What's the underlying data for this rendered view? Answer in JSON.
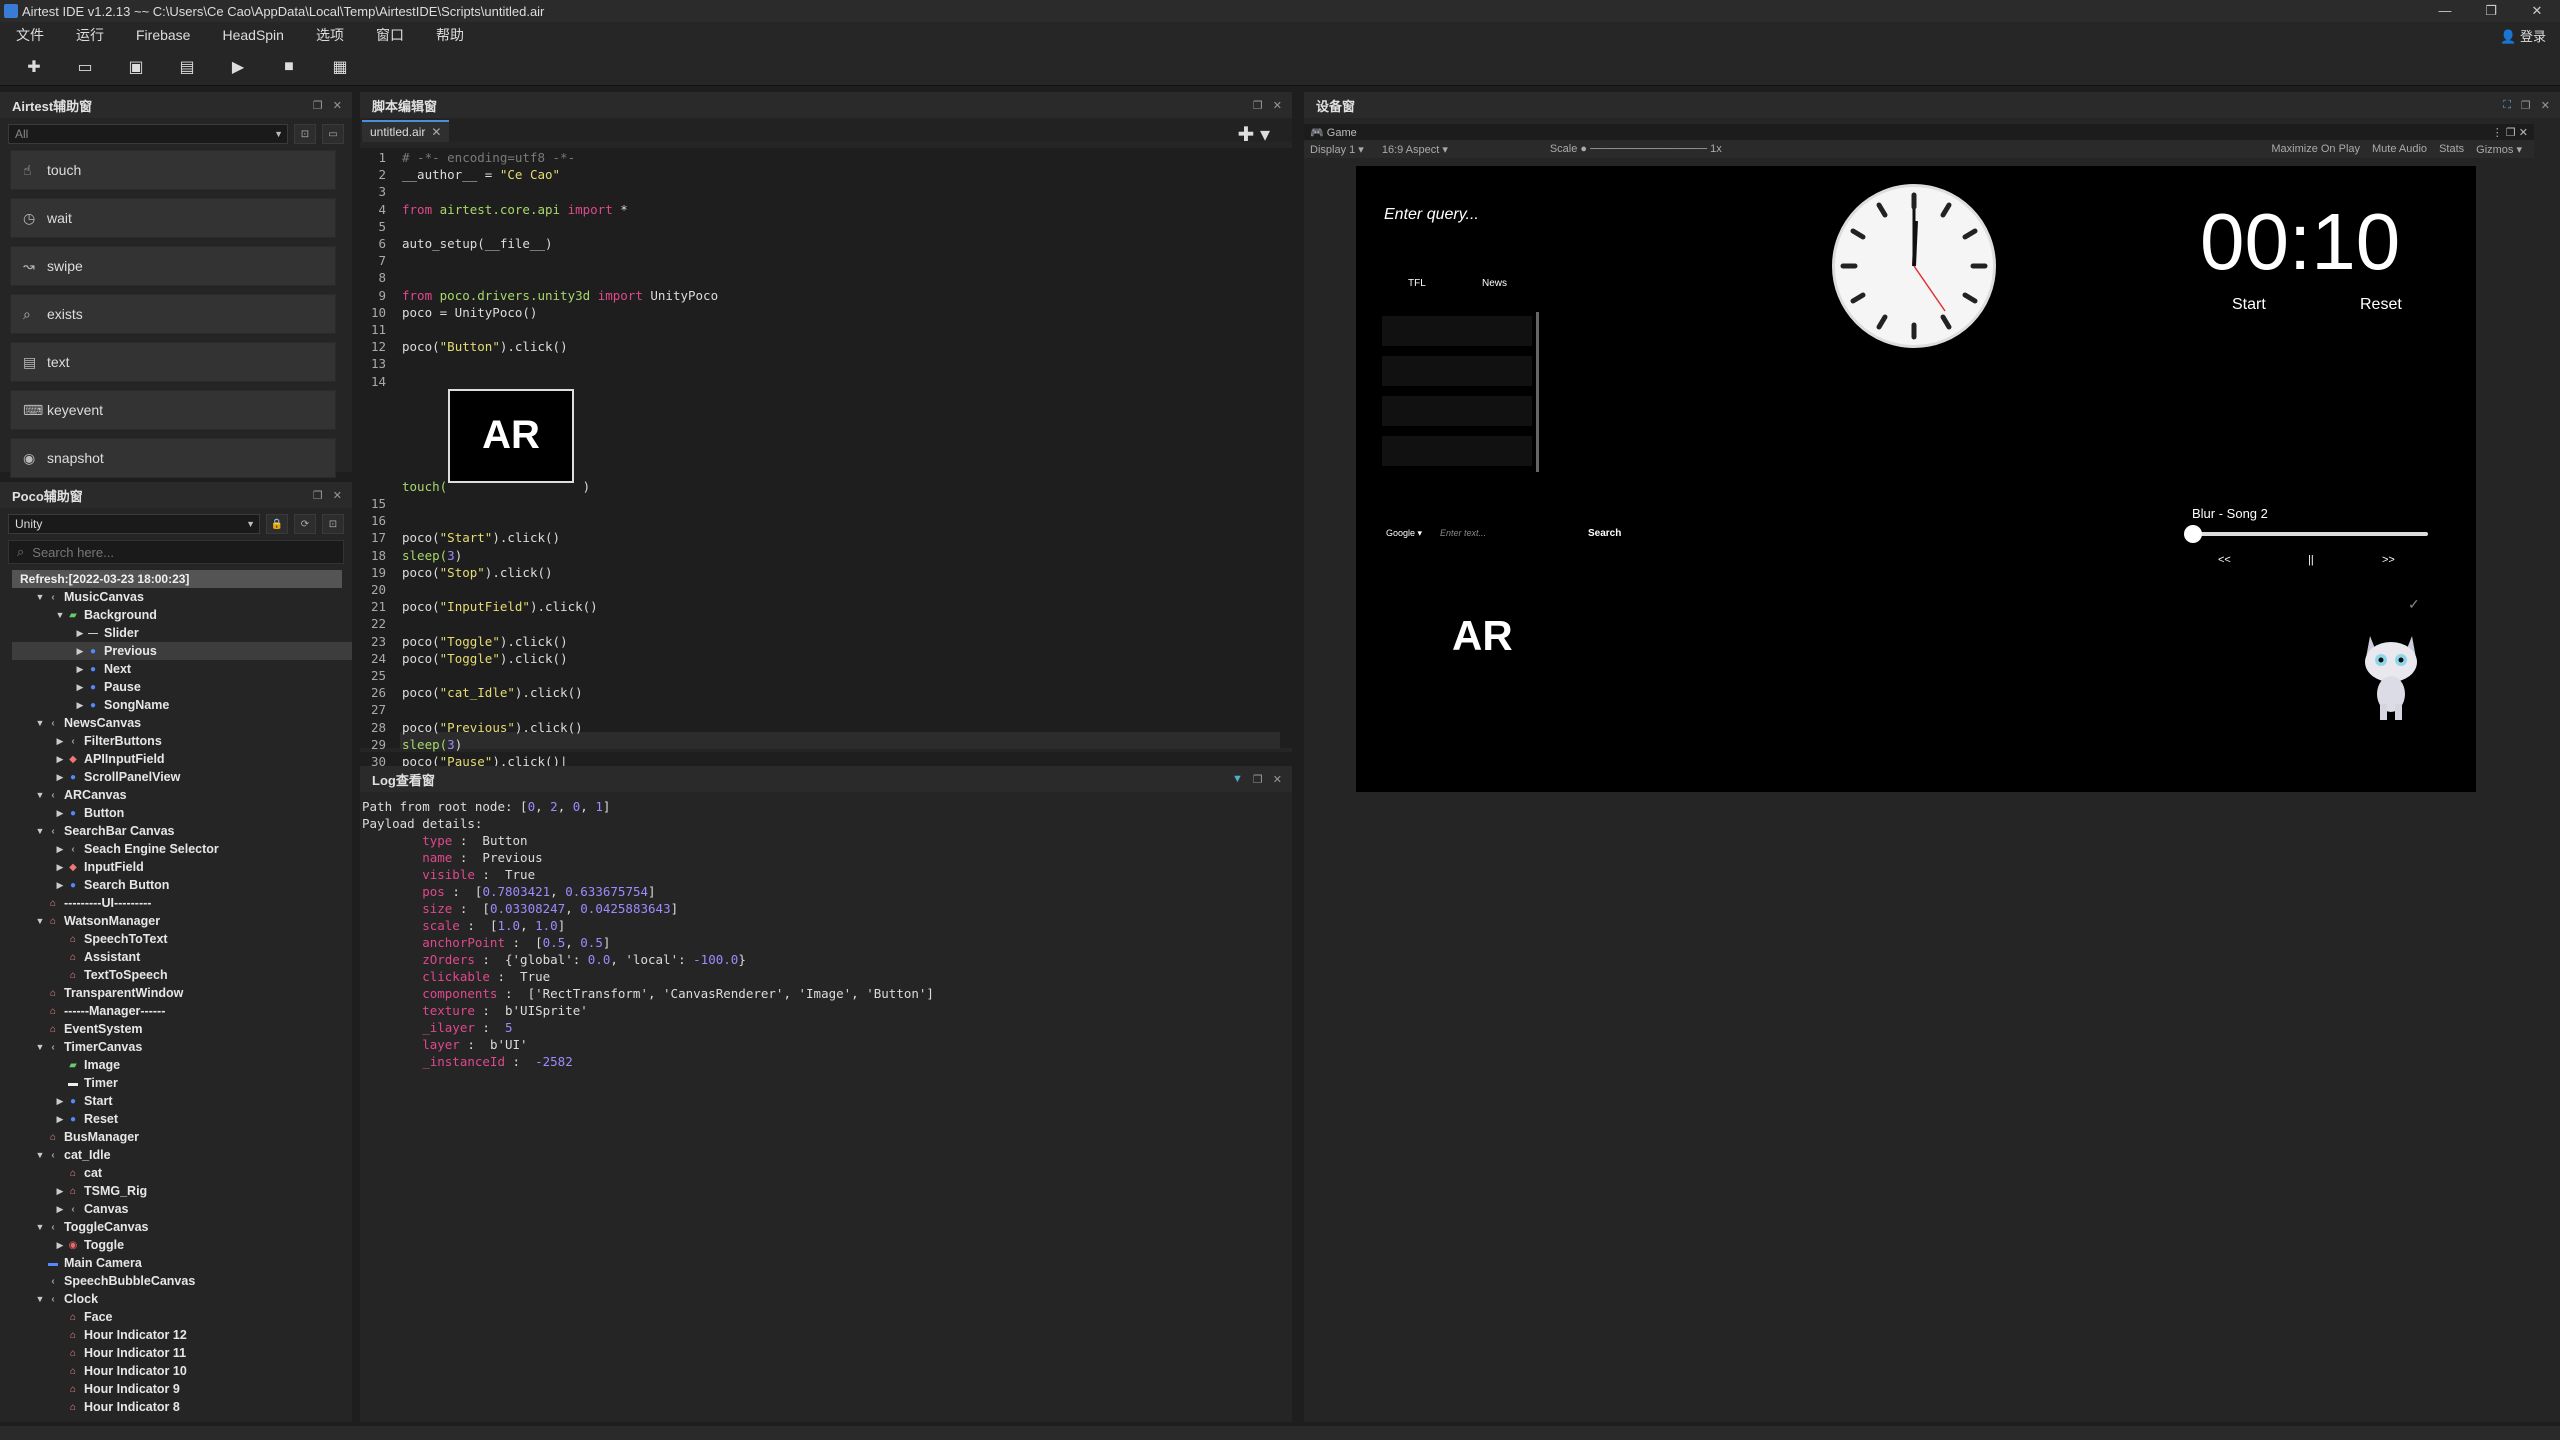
{
  "window": {
    "title": "Airtest IDE v1.2.13 ~~ C:\\Users\\Ce Cao\\AppData\\Local\\Temp\\AirtestIDE\\Scripts\\untitled.air",
    "controls": [
      "—",
      "❐",
      "✕"
    ]
  },
  "menu": {
    "items": [
      "文件",
      "运行",
      "Firebase",
      "HeadSpin",
      "选项",
      "窗口",
      "帮助"
    ],
    "login": "登录"
  },
  "toolbar": {
    "icons": [
      "new-file-icon",
      "open-folder-icon",
      "save-icon",
      "save-as-icon",
      "run-icon",
      "stop-icon",
      "log-icon"
    ]
  },
  "airtest_panel": {
    "title": "Airtest辅助窗",
    "filter": "All",
    "commands": [
      "touch",
      "wait",
      "swipe",
      "exists",
      "text",
      "keyevent",
      "snapshot"
    ]
  },
  "poco_panel": {
    "title": "Poco辅助窗",
    "mode": "Unity",
    "search_placeholder": "Search here...",
    "refresh": "Refresh:[2022-03-23 18:00:23]",
    "tree": [
      {
        "label": "MusicCanvas",
        "depth": 0,
        "arrow": "▼",
        "icon": "canvas"
      },
      {
        "label": "Background",
        "depth": 1,
        "arrow": "▼",
        "icon": "image"
      },
      {
        "label": "Slider",
        "depth": 2,
        "arrow": "▶",
        "icon": "slider"
      },
      {
        "label": "Previous",
        "depth": 2,
        "arrow": "▶",
        "icon": "button",
        "selected": true
      },
      {
        "label": "Next",
        "depth": 2,
        "arrow": "▶",
        "icon": "button"
      },
      {
        "label": "Pause",
        "depth": 2,
        "arrow": "▶",
        "icon": "button"
      },
      {
        "label": "SongName",
        "depth": 2,
        "arrow": "▶",
        "icon": "button"
      },
      {
        "label": "NewsCanvas",
        "depth": 0,
        "arrow": "▼",
        "icon": "canvas"
      },
      {
        "label": "FilterButtons",
        "depth": 1,
        "arrow": "▶",
        "icon": "canvas"
      },
      {
        "label": "APIInputField",
        "depth": 1,
        "arrow": "▶",
        "icon": "input"
      },
      {
        "label": "ScrollPanelView",
        "depth": 1,
        "arrow": "▶",
        "icon": "button"
      },
      {
        "label": "ARCanvas",
        "depth": 0,
        "arrow": "▼",
        "icon": "canvas"
      },
      {
        "label": "Button",
        "depth": 1,
        "arrow": "▶",
        "icon": "button"
      },
      {
        "label": "SearchBar Canvas",
        "depth": 0,
        "arrow": "▼",
        "icon": "canvas"
      },
      {
        "label": "Seach Engine Selector",
        "depth": 1,
        "arrow": "▶",
        "icon": "canvas"
      },
      {
        "label": "InputField",
        "depth": 1,
        "arrow": "▶",
        "icon": "input"
      },
      {
        "label": "Search Button",
        "depth": 1,
        "arrow": "▶",
        "icon": "button"
      },
      {
        "label": "---------UI---------",
        "depth": 0,
        "arrow": "",
        "icon": "node"
      },
      {
        "label": "WatsonManager",
        "depth": 0,
        "arrow": "▼",
        "icon": "node"
      },
      {
        "label": "SpeechToText",
        "depth": 1,
        "arrow": "",
        "icon": "node"
      },
      {
        "label": "Assistant",
        "depth": 1,
        "arrow": "",
        "icon": "node"
      },
      {
        "label": "TextToSpeech",
        "depth": 1,
        "arrow": "",
        "icon": "node"
      },
      {
        "label": "TransparentWindow",
        "depth": 0,
        "arrow": "",
        "icon": "node"
      },
      {
        "label": "------Manager------",
        "depth": 0,
        "arrow": "",
        "icon": "node"
      },
      {
        "label": "EventSystem",
        "depth": 0,
        "arrow": "",
        "icon": "node"
      },
      {
        "label": "TimerCanvas",
        "depth": 0,
        "arrow": "▼",
        "icon": "canvas"
      },
      {
        "label": "Image",
        "depth": 1,
        "arrow": "",
        "icon": "image"
      },
      {
        "label": "Timer",
        "depth": 1,
        "arrow": "",
        "icon": "text"
      },
      {
        "label": "Start",
        "depth": 1,
        "arrow": "▶",
        "icon": "button"
      },
      {
        "label": "Reset",
        "depth": 1,
        "arrow": "▶",
        "icon": "button"
      },
      {
        "label": "BusManager",
        "depth": 0,
        "arrow": "",
        "icon": "node"
      },
      {
        "label": "cat_Idle",
        "depth": 0,
        "arrow": "▼",
        "icon": "canvas"
      },
      {
        "label": "cat",
        "depth": 1,
        "arrow": "",
        "icon": "node"
      },
      {
        "label": "TSMG_Rig",
        "depth": 1,
        "arrow": "▶",
        "icon": "node"
      },
      {
        "label": "Canvas",
        "depth": 1,
        "arrow": "▶",
        "icon": "canvas"
      },
      {
        "label": "ToggleCanvas",
        "depth": 0,
        "arrow": "▼",
        "icon": "canvas"
      },
      {
        "label": "Toggle",
        "depth": 1,
        "arrow": "▶",
        "icon": "toggle"
      },
      {
        "label": "Main Camera",
        "depth": 0,
        "arrow": "",
        "icon": "camera"
      },
      {
        "label": "SpeechBubbleCanvas",
        "depth": 0,
        "arrow": "",
        "icon": "canvas"
      },
      {
        "label": "Clock",
        "depth": 0,
        "arrow": "▼",
        "icon": "canvas"
      },
      {
        "label": "Face",
        "depth": 1,
        "arrow": "",
        "icon": "node"
      },
      {
        "label": "Hour Indicator 12",
        "depth": 1,
        "arrow": "",
        "icon": "node"
      },
      {
        "label": "Hour Indicator 11",
        "depth": 1,
        "arrow": "",
        "icon": "node"
      },
      {
        "label": "Hour Indicator 10",
        "depth": 1,
        "arrow": "",
        "icon": "node"
      },
      {
        "label": "Hour Indicator 9",
        "depth": 1,
        "arrow": "",
        "icon": "node"
      },
      {
        "label": "Hour Indicator 8",
        "depth": 1,
        "arrow": "",
        "icon": "node"
      }
    ]
  },
  "editor": {
    "title": "脚本编辑窗",
    "tab": "untitled.air",
    "image_label": "AR",
    "lines": [
      {
        "n": "1",
        "segs": [
          {
            "t": "# -*- encoding=utf8 -*-",
            "c": "cm"
          }
        ]
      },
      {
        "n": "2",
        "segs": [
          {
            "t": "__author__ = ",
            "c": ""
          },
          {
            "t": "\"Ce Cao\"",
            "c": "st"
          }
        ]
      },
      {
        "n": "3",
        "segs": []
      },
      {
        "n": "4",
        "segs": [
          {
            "t": "from ",
            "c": "kw"
          },
          {
            "t": "airtest.core.api ",
            "c": "mod"
          },
          {
            "t": "import ",
            "c": "kw"
          },
          {
            "t": "*",
            "c": ""
          }
        ]
      },
      {
        "n": "5",
        "segs": []
      },
      {
        "n": "6",
        "segs": [
          {
            "t": "auto_setup(__file__)",
            "c": ""
          }
        ]
      },
      {
        "n": "7",
        "segs": []
      },
      {
        "n": "8",
        "segs": []
      },
      {
        "n": "9",
        "segs": [
          {
            "t": "from ",
            "c": "kw"
          },
          {
            "t": "poco.drivers.unity3d ",
            "c": "mod"
          },
          {
            "t": "import ",
            "c": "kw"
          },
          {
            "t": "UnityPoco",
            "c": ""
          }
        ]
      },
      {
        "n": "10",
        "segs": [
          {
            "t": "poco = UnityPoco()",
            "c": ""
          }
        ]
      },
      {
        "n": "11",
        "segs": []
      },
      {
        "n": "12",
        "segs": [
          {
            "t": "poco(",
            "c": ""
          },
          {
            "t": "\"Button\"",
            "c": "st"
          },
          {
            "t": ").click()",
            "c": ""
          }
        ]
      },
      {
        "n": "13",
        "segs": []
      },
      {
        "n": "14",
        "segs": []
      },
      {
        "n": "",
        "segs": [
          {
            "t": "touch(",
            "c": "mod"
          },
          {
            "t": "                  )",
            "c": ""
          }
        ]
      },
      {
        "n": "15",
        "segs": []
      },
      {
        "n": "16",
        "segs": []
      },
      {
        "n": "17",
        "segs": [
          {
            "t": "poco(",
            "c": ""
          },
          {
            "t": "\"Start\"",
            "c": "st"
          },
          {
            "t": ").click()",
            "c": ""
          }
        ]
      },
      {
        "n": "18",
        "segs": [
          {
            "t": "sleep(",
            "c": "mod"
          },
          {
            "t": "3",
            "c": "n"
          },
          {
            "t": ")",
            "c": ""
          }
        ]
      },
      {
        "n": "19",
        "segs": [
          {
            "t": "poco(",
            "c": ""
          },
          {
            "t": "\"Stop\"",
            "c": "st"
          },
          {
            "t": ").click()",
            "c": ""
          }
        ]
      },
      {
        "n": "20",
        "segs": []
      },
      {
        "n": "21",
        "segs": [
          {
            "t": "poco(",
            "c": ""
          },
          {
            "t": "\"InputField\"",
            "c": "st"
          },
          {
            "t": ").click()",
            "c": ""
          }
        ]
      },
      {
        "n": "22",
        "segs": []
      },
      {
        "n": "23",
        "segs": [
          {
            "t": "poco(",
            "c": ""
          },
          {
            "t": "\"Toggle\"",
            "c": "st"
          },
          {
            "t": ").click()",
            "c": ""
          }
        ]
      },
      {
        "n": "24",
        "segs": [
          {
            "t": "poco(",
            "c": ""
          },
          {
            "t": "\"Toggle\"",
            "c": "st"
          },
          {
            "t": ").click()",
            "c": ""
          }
        ]
      },
      {
        "n": "25",
        "segs": []
      },
      {
        "n": "26",
        "segs": [
          {
            "t": "poco(",
            "c": ""
          },
          {
            "t": "\"cat_Idle\"",
            "c": "st"
          },
          {
            "t": ").click()",
            "c": ""
          }
        ]
      },
      {
        "n": "27",
        "segs": []
      },
      {
        "n": "28",
        "segs": [
          {
            "t": "poco(",
            "c": ""
          },
          {
            "t": "\"Previous\"",
            "c": "st"
          },
          {
            "t": ").click()",
            "c": ""
          }
        ]
      },
      {
        "n": "29",
        "segs": [
          {
            "t": "sleep(",
            "c": "mod"
          },
          {
            "t": "3",
            "c": "n"
          },
          {
            "t": ")",
            "c": ""
          }
        ]
      },
      {
        "n": "30",
        "segs": [
          {
            "t": "poco(",
            "c": ""
          },
          {
            "t": "\"Pause\"",
            "c": "st"
          },
          {
            "t": ").click()|",
            "c": ""
          }
        ]
      }
    ]
  },
  "log": {
    "title": "Log查看窗",
    "lines": [
      [
        {
          "t": "Path from root node: [",
          "c": ""
        },
        {
          "t": "0",
          "c": "n"
        },
        {
          "t": ", ",
          "c": ""
        },
        {
          "t": "2",
          "c": "n"
        },
        {
          "t": ", ",
          "c": ""
        },
        {
          "t": "0",
          "c": "n"
        },
        {
          "t": ", ",
          "c": ""
        },
        {
          "t": "1",
          "c": "n"
        },
        {
          "t": "]",
          "c": ""
        }
      ],
      [
        {
          "t": "Payload details:",
          "c": ""
        }
      ],
      [
        {
          "t": "        type",
          "c": "k"
        },
        {
          "t": " :  Button",
          "c": ""
        }
      ],
      [
        {
          "t": "        name",
          "c": "k"
        },
        {
          "t": " :  Previous",
          "c": ""
        }
      ],
      [
        {
          "t": "        visible",
          "c": "k"
        },
        {
          "t": " :  True",
          "c": ""
        }
      ],
      [
        {
          "t": "        pos",
          "c": "k"
        },
        {
          "t": " :  [",
          "c": ""
        },
        {
          "t": "0.7803421",
          "c": "n"
        },
        {
          "t": ", ",
          "c": ""
        },
        {
          "t": "0.633675754",
          "c": "n"
        },
        {
          "t": "]",
          "c": ""
        }
      ],
      [
        {
          "t": "        size",
          "c": "k"
        },
        {
          "t": " :  [",
          "c": ""
        },
        {
          "t": "0.03308247",
          "c": "n"
        },
        {
          "t": ", ",
          "c": ""
        },
        {
          "t": "0.0425883643",
          "c": "n"
        },
        {
          "t": "]",
          "c": ""
        }
      ],
      [
        {
          "t": "        scale",
          "c": "k"
        },
        {
          "t": " :  [",
          "c": ""
        },
        {
          "t": "1.0",
          "c": "n"
        },
        {
          "t": ", ",
          "c": ""
        },
        {
          "t": "1.0",
          "c": "n"
        },
        {
          "t": "]",
          "c": ""
        }
      ],
      [
        {
          "t": "        anchorPoint",
          "c": "k"
        },
        {
          "t": " :  [",
          "c": ""
        },
        {
          "t": "0.5",
          "c": "n"
        },
        {
          "t": ", ",
          "c": ""
        },
        {
          "t": "0.5",
          "c": "n"
        },
        {
          "t": "]",
          "c": ""
        }
      ],
      [
        {
          "t": "        zOrders",
          "c": "k"
        },
        {
          "t": " :  {'global': ",
          "c": ""
        },
        {
          "t": "0.0",
          "c": "n"
        },
        {
          "t": ", 'local': ",
          "c": ""
        },
        {
          "t": "-100.0",
          "c": "n"
        },
        {
          "t": "}",
          "c": ""
        }
      ],
      [
        {
          "t": "        clickable",
          "c": "k"
        },
        {
          "t": " :  True",
          "c": ""
        }
      ],
      [
        {
          "t": "        components",
          "c": "k"
        },
        {
          "t": " :  ['RectTransform', 'CanvasRenderer', 'Image', 'Button']",
          "c": ""
        }
      ],
      [
        {
          "t": "        texture",
          "c": "k"
        },
        {
          "t": " :  b'UISprite'",
          "c": ""
        }
      ],
      [
        {
          "t": "        _ilayer",
          "c": "k"
        },
        {
          "t": " :  ",
          "c": ""
        },
        {
          "t": "5",
          "c": "n"
        }
      ],
      [
        {
          "t": "        layer",
          "c": "k"
        },
        {
          "t": " :  b'UI'",
          "c": ""
        }
      ],
      [
        {
          "t": "        _instanceId",
          "c": "k"
        },
        {
          "t": " :  ",
          "c": ""
        },
        {
          "t": "-2582",
          "c": "n"
        }
      ]
    ]
  },
  "device": {
    "title": "设备窗",
    "game_tab": "Game",
    "display": "Display 1",
    "aspect": "16:9 Aspect",
    "scale_label": "Scale",
    "scale_value": "1x",
    "options": [
      "Maximize On Play",
      "Mute Audio",
      "Stats",
      "Gizmos"
    ],
    "game": {
      "query": "Enter query...",
      "filter_tabs": [
        "TFL",
        "News"
      ],
      "search_engine": "Google",
      "search_placeholder": "Enter text...",
      "search_button": "Search",
      "timer": "00:10",
      "start": "Start",
      "reset": "Reset",
      "song": "Blur - Song 2",
      "prev": "<<",
      "pause": "||",
      "next": ">>",
      "ar": "AR",
      "slider_level": 0.02
    }
  }
}
